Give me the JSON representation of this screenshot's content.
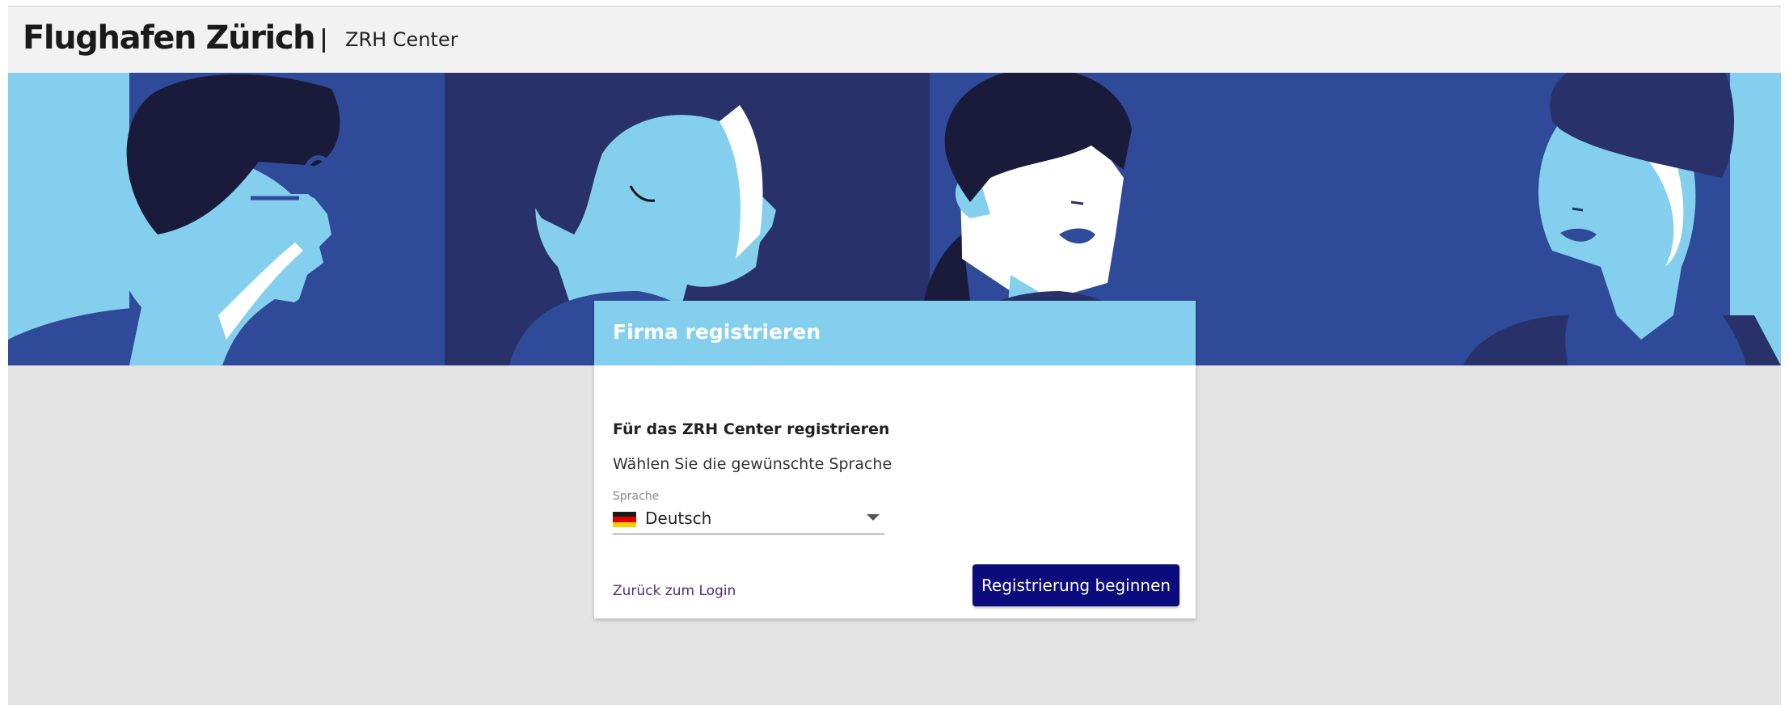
{
  "header": {
    "brand": "Flughafen Zürich",
    "app_name": "ZRH Center"
  },
  "hero": {
    "illustration": "four stylized faces in blue tones"
  },
  "card": {
    "title": "Firma registrieren",
    "subtitle": "Für das ZRH Center registrieren",
    "prompt": "Wählen Sie die gewünschte Sprache",
    "language_select": {
      "label": "Sprache",
      "value": "Deutsch",
      "flag_icon": "flag-de-icon"
    },
    "back_link": "Zurück zum Login",
    "primary_button": "Registrierung beginnen"
  },
  "colors": {
    "card_header": "#84cfee",
    "primary_button": "#0b0b7e",
    "link": "#5a2a7a",
    "hero_dark_blue": "#2f4a98",
    "hero_light_blue": "#84cfee"
  }
}
